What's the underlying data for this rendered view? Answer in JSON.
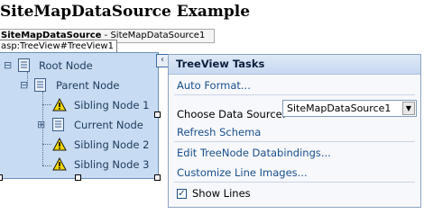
{
  "page_heading": "SiteMapDataSource Example",
  "datasource_control": {
    "name": "SiteMapDataSource",
    "separator": " - ",
    "id": "SiteMapDataSource1"
  },
  "treeview_tag": "asp:TreeView#TreeView1",
  "tree": {
    "nodes": [
      {
        "label": "Root Node",
        "expander": "⊟",
        "icon": "sitemap-node-icon"
      },
      {
        "label": "Parent Node",
        "expander": "⊟",
        "icon": "sitemap-node-icon"
      },
      {
        "label": "Sibling Node 1",
        "icon": "warning-icon"
      },
      {
        "label": "Current Node",
        "expander": "⊞",
        "icon": "sitemap-node-icon"
      },
      {
        "label": "Sibling Node 2",
        "icon": "warning-icon"
      },
      {
        "label": "Sibling Node 3",
        "icon": "warning-icon"
      }
    ]
  },
  "smart_tag": {
    "glyph": "‹"
  },
  "tasks": {
    "title": "TreeView Tasks",
    "auto_format": "Auto Format...",
    "choose_ds_label": "Choose Data Source:",
    "choose_ds_value": "SiteMapDataSource1",
    "refresh_schema": "Refresh Schema",
    "edit_bindings": "Edit TreeNode Databindings...",
    "customize_lines": "Customize Line Images...",
    "show_lines_label": "Show Lines",
    "show_lines_checked": true,
    "checkmark": "✓"
  },
  "colors": {
    "tree_background": "#c7dcf3",
    "link": "#1a4f8c",
    "warning_fill": "#f2d600"
  }
}
